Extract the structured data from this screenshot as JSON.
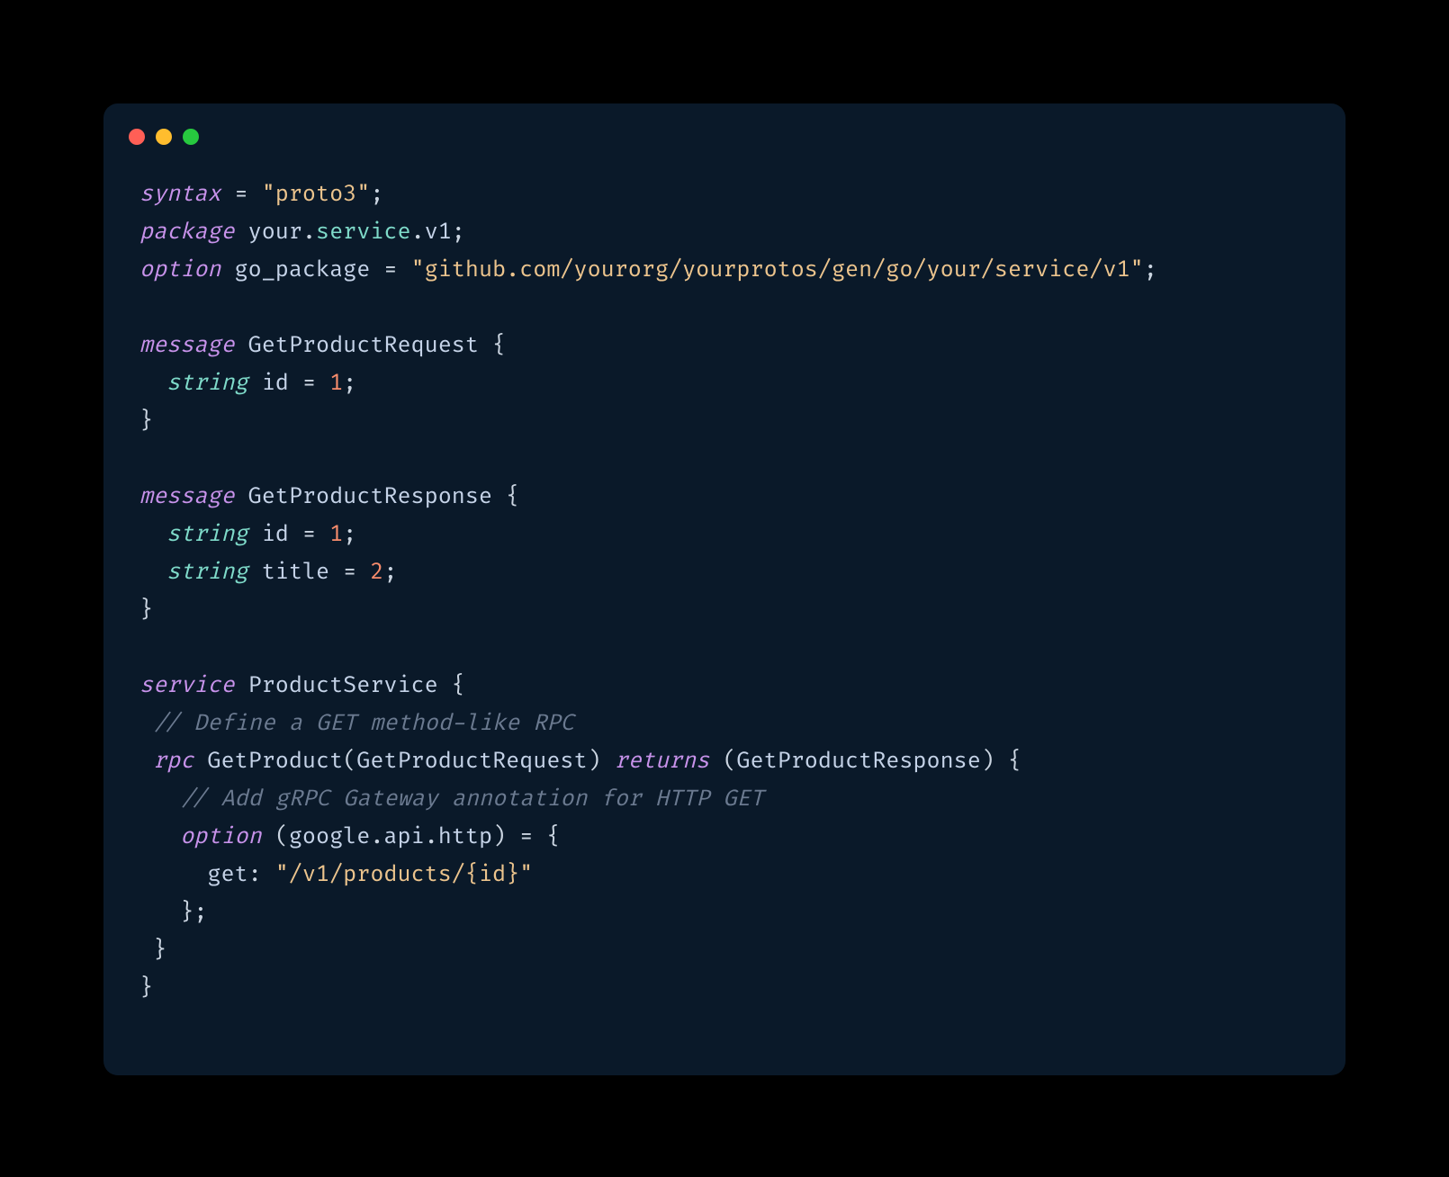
{
  "code": {
    "syntax_kw": "syntax",
    "syntax_val": "\"proto3\"",
    "package_kw": "package",
    "pkg_your": "your",
    "pkg_service": "service",
    "pkg_v1": "v1",
    "option_kw": "option",
    "go_package": "go_package",
    "go_package_val": "\"github.com/yourorg/yourprotos/gen/go/your/service/v1\"",
    "message_kw": "message",
    "msg1_name": "GetProductRequest",
    "string_kw": "string",
    "field_id": "id",
    "one": "1",
    "msg2_name": "GetProductResponse",
    "field_title": "title",
    "two": "2",
    "service_kw": "service",
    "svc_name": "ProductService",
    "comment1": "// Define a GET method-like RPC",
    "rpc_kw": "rpc",
    "rpc_name": "GetProduct",
    "rpc_req": "GetProductRequest",
    "returns_kw": "returns",
    "rpc_resp": "GetProductResponse",
    "comment2": "// Add gRPC Gateway annotation for HTTP GET",
    "opt_google": "google",
    "opt_api": "api",
    "opt_http": "http",
    "get_key": "get",
    "get_val": "\"/v1/products/{id}\"",
    "eq": "=",
    "semi": ";",
    "colon": ":",
    "dot": ".",
    "lbrace": "{",
    "rbrace": "}",
    "lparen": "(",
    "rparen": ")"
  }
}
